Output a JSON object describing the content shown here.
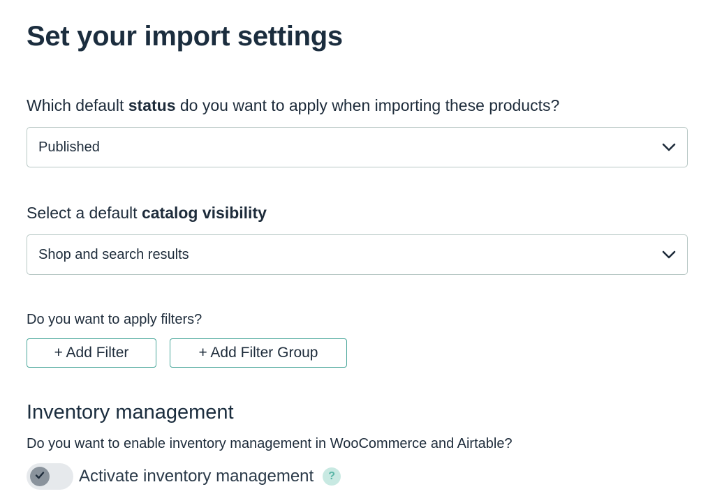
{
  "page": {
    "title": "Set your import settings"
  },
  "status": {
    "question_prefix": "Which default ",
    "question_bold": "status",
    "question_suffix": " do you want to apply when importing these products?",
    "selected": "Published"
  },
  "visibility": {
    "question_prefix": "Select a default ",
    "question_bold": "catalog visibility",
    "selected": "Shop and search results"
  },
  "filters": {
    "question": "Do you want to apply filters?",
    "add_filter_label": "+ Add Filter",
    "add_filter_group_label": "+ Add Filter Group"
  },
  "inventory": {
    "title": "Inventory management",
    "question": "Do you want to enable inventory management in WooCommerce and Airtable?",
    "toggle_label": "Activate inventory management",
    "help_glyph": "?"
  },
  "icons": {
    "chevron": "chevron-down-icon",
    "check": "check-icon",
    "help": "question-mark-icon"
  },
  "colors": {
    "text": "#1d2b3a",
    "button_border": "#4aa79b",
    "help_bg": "#c8e9e2",
    "help_fg": "#58b5a6"
  }
}
